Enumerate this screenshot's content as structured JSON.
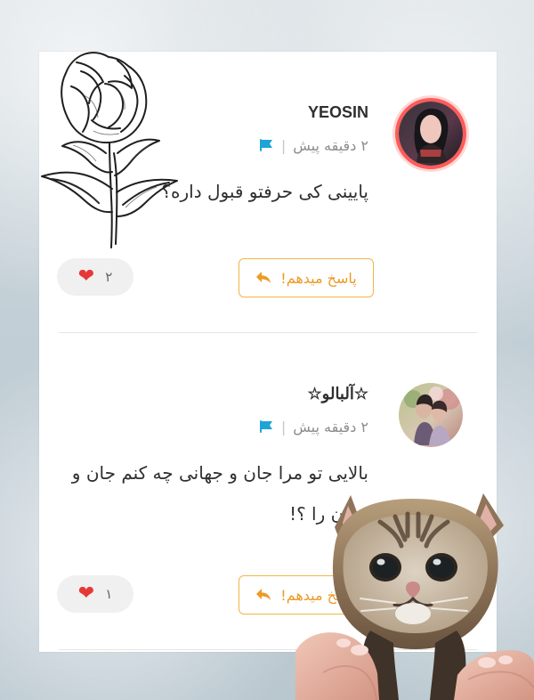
{
  "comments": [
    {
      "username": "YEOSIN",
      "time_ago": "۲ دقیقه پیش",
      "separator": "|",
      "text_lines": [
        "پایینی کی حرفتو قبول داره؟"
      ],
      "reply_label": "پاسخ میدهم!",
      "likes": "۲"
    },
    {
      "username": "☆آلبالو☆",
      "time_ago": "۲ دقیقه پیش",
      "separator": "|",
      "text_lines": [
        "بالایی تو مرا جان و جهانی چه کنم جان و",
        "جهان را ؟!"
      ],
      "reply_label": "پاسخ میدهم!",
      "likes": "۱"
    }
  ],
  "icons": {
    "flag": "flag-icon",
    "reply": "reply-icon",
    "heart": "heart-icon"
  },
  "colors": {
    "reply_border": "#f3b445",
    "reply_text": "#ec9a24",
    "flag": "#1ea4d8",
    "heart": "#e53935",
    "avatar_ring": "#ff5b58"
  }
}
